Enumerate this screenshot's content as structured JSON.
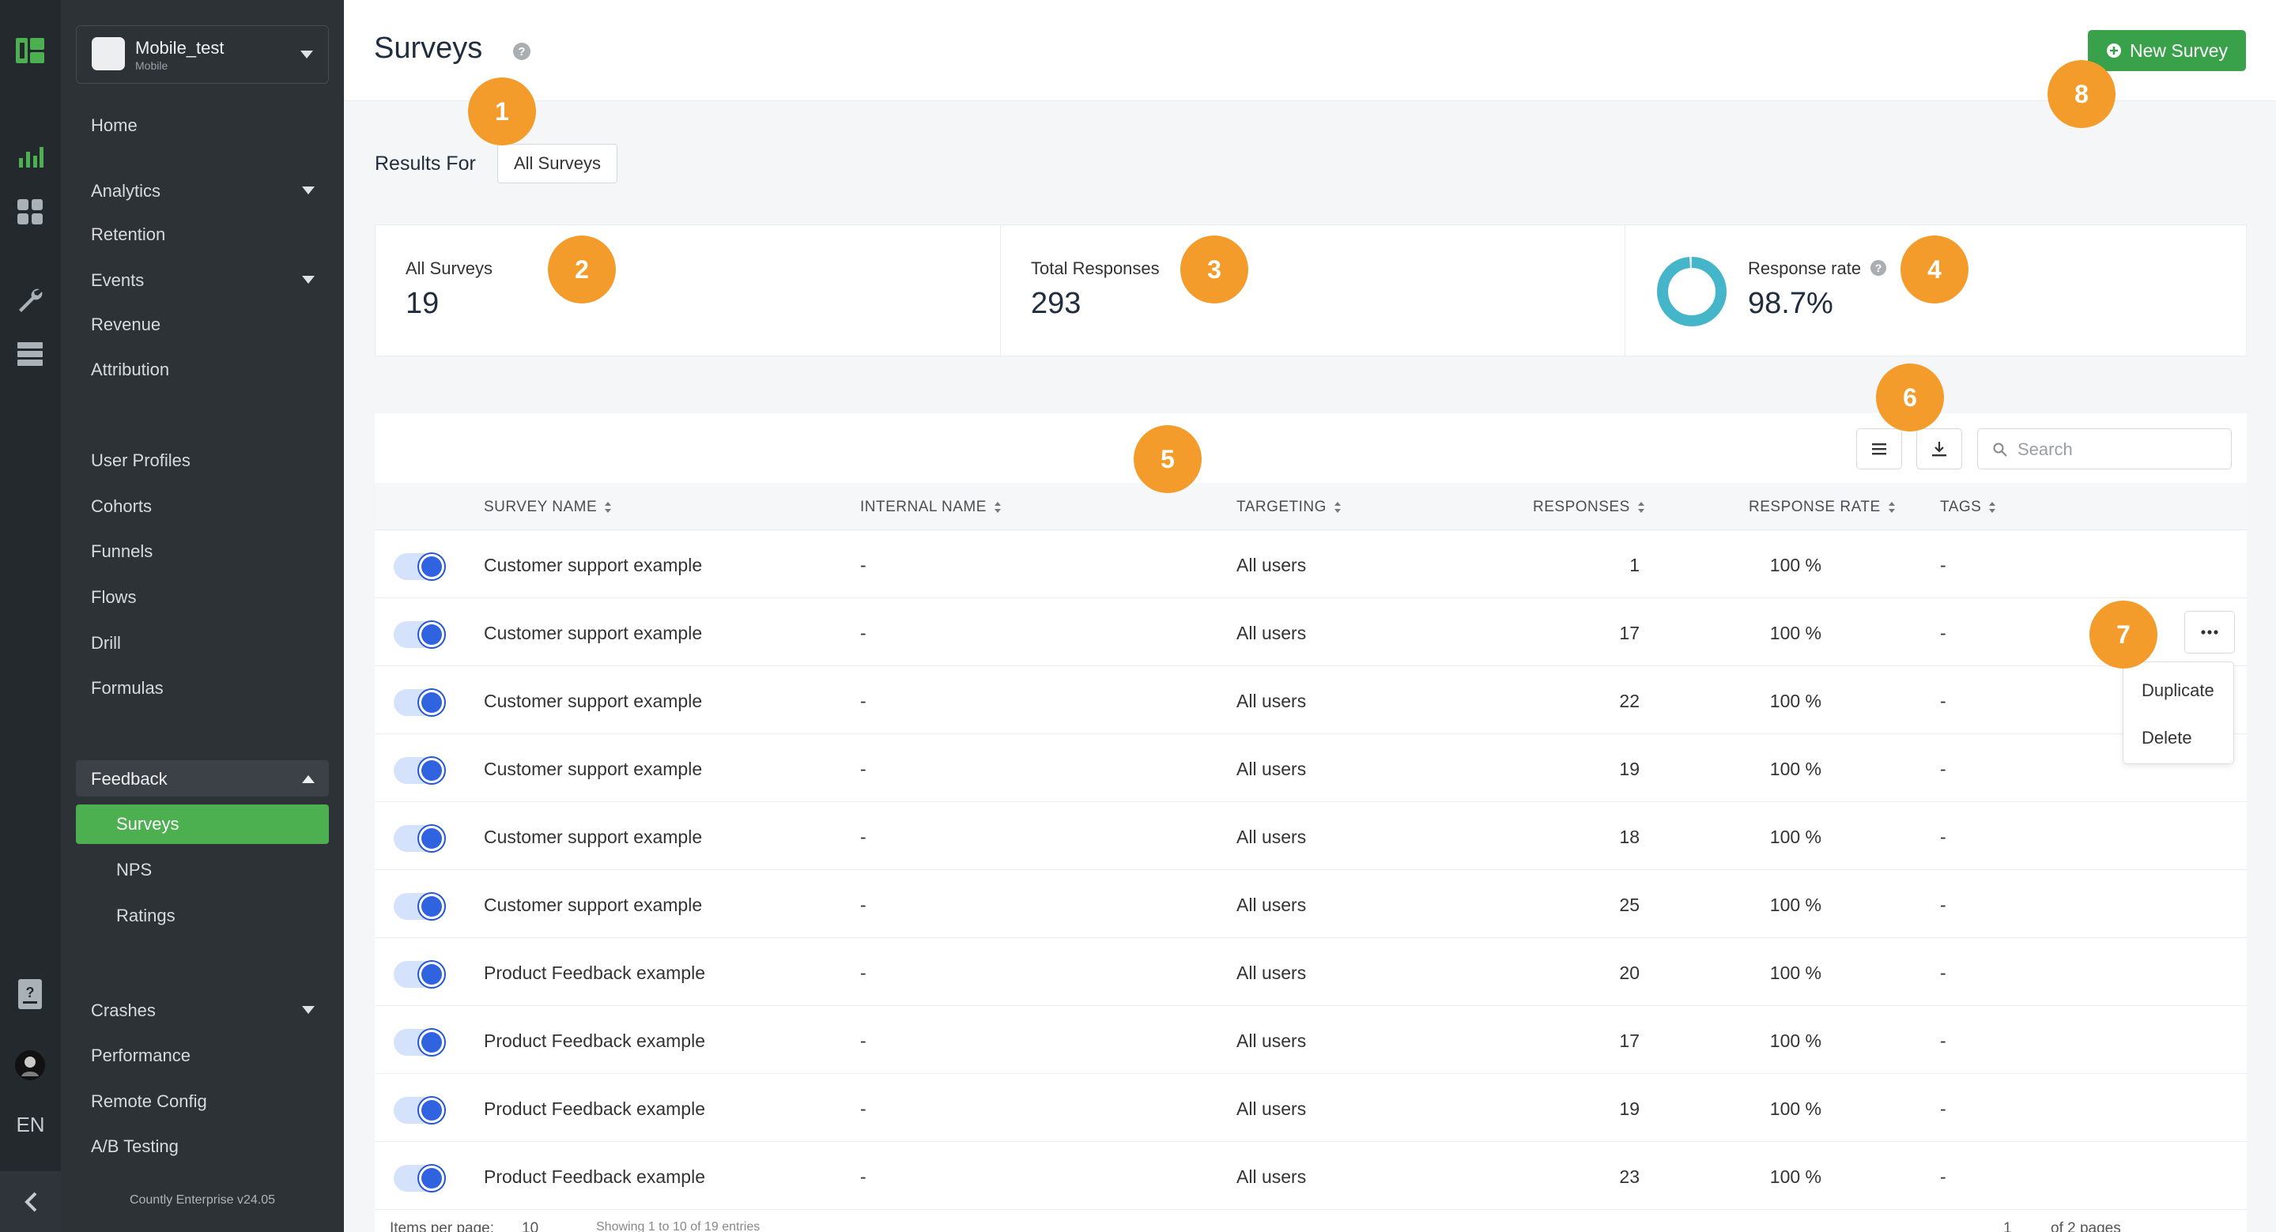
{
  "app": {
    "name": "Mobile_test",
    "type": "Mobile",
    "version": "Countly Enterprise v24.05",
    "language": "EN"
  },
  "colors": {
    "accent": "#4caf50",
    "primary_button": "#38a149",
    "callout": "#f39c2b",
    "toggle_on": "#2f63e0",
    "donut": "#45b6c9"
  },
  "rail_icons": [
    "countly-logo-icon",
    "analytics-bars-icon",
    "dashboards-grid-icon",
    "wrench-icon",
    "data-manager-icon",
    "help-document-icon",
    "user-avatar-icon"
  ],
  "sidebar": {
    "top": [
      {
        "label": "Home"
      },
      {
        "label": "Analytics",
        "expandable": true
      },
      {
        "label": "Retention"
      },
      {
        "label": "Events",
        "expandable": true
      },
      {
        "label": "Revenue"
      },
      {
        "label": "Attribution"
      }
    ],
    "middle": [
      {
        "label": "User Profiles"
      },
      {
        "label": "Cohorts"
      },
      {
        "label": "Funnels"
      },
      {
        "label": "Flows"
      },
      {
        "label": "Drill"
      },
      {
        "label": "Formulas"
      }
    ],
    "feedback": {
      "label": "Feedback",
      "children": [
        "Surveys",
        "NPS",
        "Ratings"
      ],
      "active": "Surveys"
    },
    "bottom": [
      {
        "label": "Crashes",
        "expandable": true
      },
      {
        "label": "Performance"
      },
      {
        "label": "Remote Config"
      },
      {
        "label": "A/B Testing"
      }
    ]
  },
  "header": {
    "title": "Surveys",
    "new_button": "New Survey"
  },
  "filter": {
    "label": "Results For",
    "value": "All Surveys"
  },
  "stats": {
    "all_surveys": {
      "label": "All Surveys",
      "value": "19"
    },
    "total_responses": {
      "label": "Total Responses",
      "value": "293"
    },
    "response_rate": {
      "label": "Response rate",
      "value": "98.7%",
      "fraction": 0.987
    }
  },
  "search": {
    "placeholder": "Search"
  },
  "table": {
    "columns": [
      "SURVEY NAME",
      "INTERNAL NAME",
      "TARGETING",
      "RESPONSES",
      "RESPONSE RATE",
      "TAGS"
    ],
    "rows": [
      {
        "enabled": true,
        "name": "Customer support example",
        "internal": "-",
        "targeting": "All users",
        "responses": "1",
        "rate": "100 %",
        "tags": "-"
      },
      {
        "enabled": true,
        "name": "Customer support example",
        "internal": "-",
        "targeting": "All users",
        "responses": "17",
        "rate": "100 %",
        "tags": "-"
      },
      {
        "enabled": true,
        "name": "Customer support example",
        "internal": "-",
        "targeting": "All users",
        "responses": "22",
        "rate": "100 %",
        "tags": "-"
      },
      {
        "enabled": true,
        "name": "Customer support example",
        "internal": "-",
        "targeting": "All users",
        "responses": "19",
        "rate": "100 %",
        "tags": "-"
      },
      {
        "enabled": true,
        "name": "Customer support example",
        "internal": "-",
        "targeting": "All users",
        "responses": "18",
        "rate": "100 %",
        "tags": "-"
      },
      {
        "enabled": true,
        "name": "Customer support example",
        "internal": "-",
        "targeting": "All users",
        "responses": "25",
        "rate": "100 %",
        "tags": "-"
      },
      {
        "enabled": true,
        "name": "Product Feedback example",
        "internal": "-",
        "targeting": "All users",
        "responses": "20",
        "rate": "100 %",
        "tags": "-"
      },
      {
        "enabled": true,
        "name": "Product Feedback example",
        "internal": "-",
        "targeting": "All users",
        "responses": "17",
        "rate": "100 %",
        "tags": "-"
      },
      {
        "enabled": true,
        "name": "Product Feedback example",
        "internal": "-",
        "targeting": "All users",
        "responses": "19",
        "rate": "100 %",
        "tags": "-"
      },
      {
        "enabled": true,
        "name": "Product Feedback example",
        "internal": "-",
        "targeting": "All users",
        "responses": "23",
        "rate": "100 %",
        "tags": "-"
      }
    ]
  },
  "row_menu": {
    "items": [
      "Duplicate",
      "Delete"
    ]
  },
  "pagination": {
    "items_label": "Items per page:",
    "items_value": "10",
    "showing": "Showing 1 to 10 of 19 entries",
    "page": "1",
    "pages_label": "of 2 pages"
  },
  "callouts": [
    "1",
    "2",
    "3",
    "4",
    "5",
    "6",
    "7",
    "8"
  ]
}
